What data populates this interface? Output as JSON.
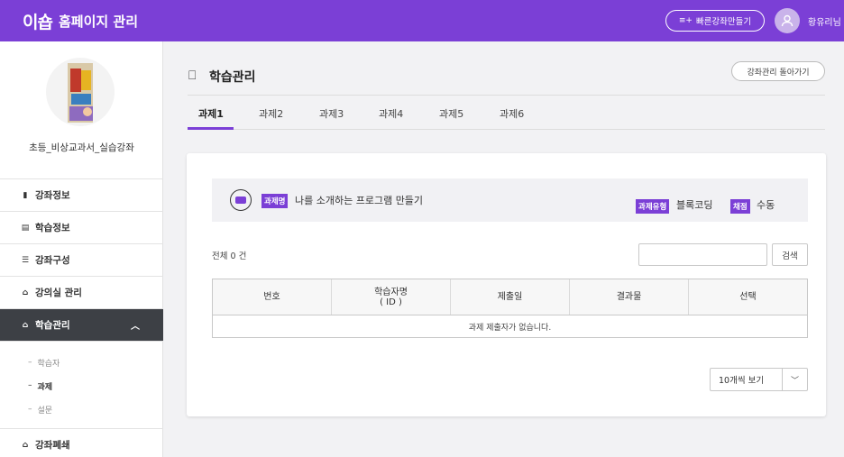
{
  "header": {
    "logo": "이숍",
    "title": "홈페이지 관리",
    "quick_button": "빠른강좌만들기",
    "username": "황유리님"
  },
  "sidebar": {
    "course_name": "초등_비상교과서_실습강좌",
    "items": [
      {
        "label": "강좌정보",
        "icon": "info-icon"
      },
      {
        "label": "학습정보",
        "icon": "book-icon"
      },
      {
        "label": "강좌구성",
        "icon": "list-icon"
      },
      {
        "label": "강의실 관리",
        "icon": "building-icon"
      },
      {
        "label": "학습관리",
        "icon": "building-icon"
      },
      {
        "label": "강좌폐쇄",
        "icon": "building-icon"
      }
    ],
    "submenu": [
      "학습자",
      "과제",
      "설문"
    ]
  },
  "main": {
    "title": "학습관리",
    "back_button": "강좌관리 돌아가기",
    "tabs": [
      "과제1",
      "과제2",
      "과제3",
      "과제4",
      "과제5",
      "과제6"
    ],
    "assignment": {
      "label": "과제명",
      "name": "나를 소개하는 프로그램 만들기",
      "type_label": "과제유형",
      "type_value": "블록코딩",
      "grade_label": "채점",
      "grade_value": "수동"
    },
    "total": "전체 0 건",
    "search_button": "검색",
    "columns": [
      "번호",
      "학습자명\n( ID )",
      "제출일",
      "결과물",
      "선택"
    ],
    "empty_message": "과제 제출자가 없습니다.",
    "per_page": "10개씩 보기"
  },
  "colors": {
    "accent": "#7b3fd6",
    "active_menu": "#3d4045"
  }
}
